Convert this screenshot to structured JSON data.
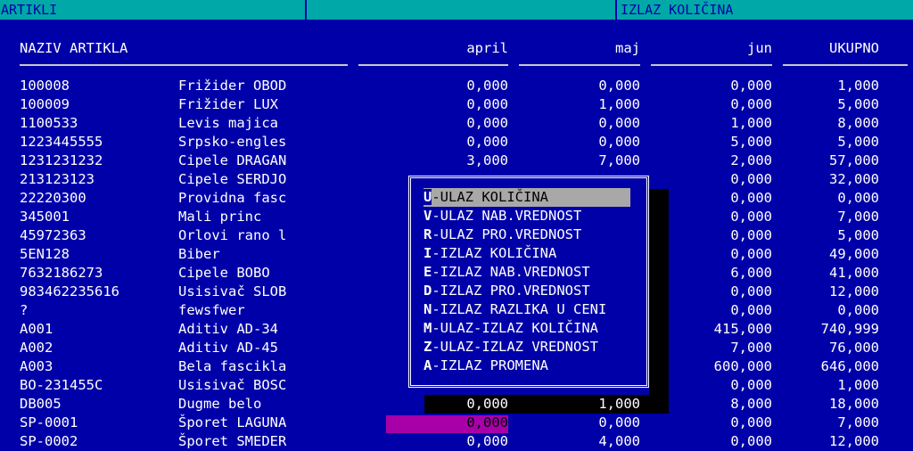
{
  "titlebar": {
    "left_title": "ARTIKLI",
    "right_title": "IZLAZ KOLIČINA"
  },
  "columns": {
    "name": "NAZIV ARTIKLA",
    "apr": "april",
    "maj": "maj",
    "jun": "jun",
    "uk": "UKUPNO"
  },
  "rows": [
    {
      "code": "100008",
      "name": "Frižider OBOD",
      "apr": "0,000",
      "maj": "0,000",
      "jun": "0,000",
      "uk": "1,000"
    },
    {
      "code": "100009",
      "name": "Frižider LUX",
      "apr": "0,000",
      "maj": "1,000",
      "jun": "0,000",
      "uk": "5,000"
    },
    {
      "code": "1100533",
      "name": "Levis majica",
      "apr": "0,000",
      "maj": "0,000",
      "jun": "1,000",
      "uk": "8,000"
    },
    {
      "code": "1223445555",
      "name": "Srpsko-engles",
      "apr": "0,000",
      "maj": "0,000",
      "jun": "5,000",
      "uk": "5,000"
    },
    {
      "code": "1231231232",
      "name": "Cipele DRAGAN",
      "apr": "3,000",
      "maj": "7,000",
      "jun": "2,000",
      "uk": "57,000"
    },
    {
      "code": "213123123",
      "name": "Cipele SERDJO",
      "apr": "",
      "maj": "",
      "jun": "0,000",
      "uk": "32,000"
    },
    {
      "code": "22220300",
      "name": "Providna fasc",
      "apr": "",
      "maj": "",
      "jun": "0,000",
      "uk": "0,000"
    },
    {
      "code": "345001",
      "name": "Mali princ",
      "apr": "",
      "maj": "",
      "jun": "0,000",
      "uk": "7,000"
    },
    {
      "code": "45972363",
      "name": "Orlovi rano l",
      "apr": "",
      "maj": "",
      "jun": "0,000",
      "uk": "5,000"
    },
    {
      "code": "5EN128",
      "name": "Biber",
      "apr": "",
      "maj": "",
      "jun": "0,000",
      "uk": "49,000"
    },
    {
      "code": "7632186273",
      "name": "Cipele BOBO",
      "apr": "",
      "maj": "",
      "jun": "6,000",
      "uk": "41,000"
    },
    {
      "code": "983462235616",
      "name": "Usisivač SLOB",
      "apr": "",
      "maj": "",
      "jun": "0,000",
      "uk": "12,000"
    },
    {
      "code": "?",
      "name": "fewsfwer",
      "apr": "",
      "maj": "",
      "jun": "0,000",
      "uk": "0,000"
    },
    {
      "code": "A001",
      "name": "Aditiv AD-34",
      "apr": "",
      "maj": "",
      "jun": "415,000",
      "uk": "740,999"
    },
    {
      "code": "A002",
      "name": "Aditiv AD-45",
      "apr": "",
      "maj": "",
      "jun": "7,000",
      "uk": "76,000"
    },
    {
      "code": "A003",
      "name": "Bela fascikla",
      "apr": "",
      "maj": "",
      "jun": "600,000",
      "uk": "646,000"
    },
    {
      "code": "BO-231455C",
      "name": "Usisivač BOSC",
      "apr": "",
      "maj": "",
      "jun": "0,000",
      "uk": "1,000"
    },
    {
      "code": "DB005",
      "name": "Dugme belo",
      "apr": "0,000",
      "maj": "1,000",
      "jun": "8,000",
      "uk": "18,000"
    },
    {
      "code": "SP-0001",
      "name": "Šporet LAGUNA",
      "apr": "0,000",
      "maj": "0,000",
      "jun": "0,000",
      "uk": "7,000"
    },
    {
      "code": "SP-0002",
      "name": "Šporet SMEDER",
      "apr": "0,000",
      "maj": "4,000",
      "jun": "0,000",
      "uk": "12,000"
    }
  ],
  "menu": [
    {
      "key": "U",
      "label": "-ULAZ KOLIČINA"
    },
    {
      "key": "V",
      "label": "-ULAZ NAB.VREDNOST"
    },
    {
      "key": "R",
      "label": "-ULAZ PRO.VREDNOST"
    },
    {
      "key": "I",
      "label": "-IZLAZ KOLIČINA"
    },
    {
      "key": "E",
      "label": "-IZLAZ NAB.VREDNOST"
    },
    {
      "key": "D",
      "label": "-IZLAZ PRO.VREDNOST"
    },
    {
      "key": "N",
      "label": "-IZLAZ RAZLIKA U CENI"
    },
    {
      "key": "M",
      "label": "-ULAZ-IZLAZ KOLIČINA"
    },
    {
      "key": "Z",
      "label": "-ULAZ-IZLAZ VREDNOST"
    },
    {
      "key": "A",
      "label": "-IZLAZ PROMENA"
    }
  ],
  "colors": {
    "background": "#0000a8",
    "titlebar": "#00a8a8",
    "highlight": "#a8a8a8",
    "cursor": "#a800a8"
  }
}
